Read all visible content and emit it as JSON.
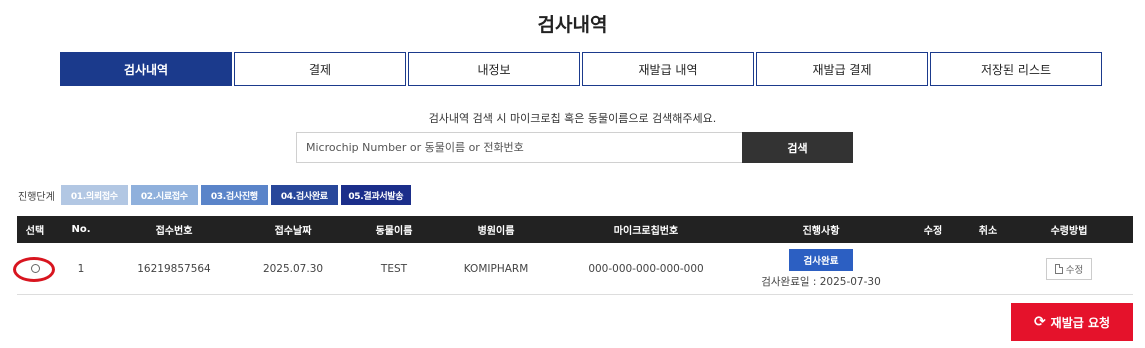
{
  "page_title": "검사내역",
  "tabs": [
    {
      "label": "검사내역",
      "active": true
    },
    {
      "label": "결제",
      "active": false
    },
    {
      "label": "내정보",
      "active": false
    },
    {
      "label": "재발급 내역",
      "active": false
    },
    {
      "label": "재발급 결제",
      "active": false
    },
    {
      "label": "저장된 리스트",
      "active": false
    }
  ],
  "search": {
    "hint": "검사내역 검색 시 마이크로칩 혹은 동물이름으로 검색해주세요.",
    "placeholder": "Microchip Number or 동물이름 or 전화번호",
    "button_label": "검색"
  },
  "stages": {
    "label": "진행단계",
    "items": [
      "01.의뢰접수",
      "02.시료접수",
      "03.검사진행",
      "04.검사완료",
      "05.결과서발송"
    ]
  },
  "table": {
    "headers": [
      "선택",
      "No.",
      "접수번호",
      "접수날짜",
      "동물이름",
      "병원이름",
      "마이크로칩번호",
      "진행사항",
      "수정",
      "취소",
      "수령방법"
    ],
    "rows": [
      {
        "no": "1",
        "receipt_no": "16219857564",
        "date": "2025.07.30",
        "animal": "TEST",
        "hospital": "KOMIPHARM",
        "chip": "000-000-000-000-000",
        "status_badge": "검사완료",
        "status_date": "검사완료일 : 2025-07-30",
        "edit_label": "수정"
      }
    ]
  },
  "reissue_button": "재발급 요청",
  "colors": {
    "primary": "#1b3a8c",
    "badge": "#2c5fc2",
    "danger": "#e5122b",
    "header_bg": "#222222"
  }
}
